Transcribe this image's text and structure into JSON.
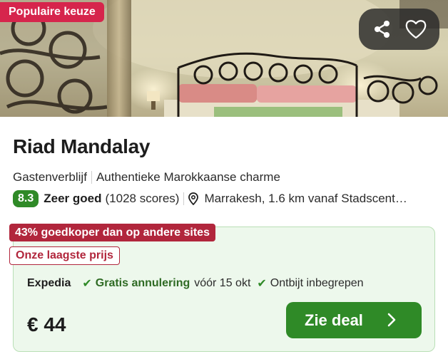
{
  "card": {
    "badge": "Populaire keuze",
    "title": "Riad Mandalay",
    "type": "Gastenverblijf",
    "tagline": "Authentieke Marokkaanse charme",
    "rating": {
      "score": "8.3",
      "label": "Zeer goed",
      "count": "(1028 scores)"
    },
    "location": "Marrakesh, 1.6 km vanaf Stadscentrum"
  },
  "icons": [
    "share-icon",
    "heart-icon",
    "checkmark-icon",
    "location-pin-icon",
    "chevron-right-icon"
  ],
  "deal": {
    "discount_tag": "43% goedkoper dan op andere sites",
    "lowest_tag": "Onze laagste prijs",
    "provider": "Expedia",
    "cancellation_label": "Gratis annulering",
    "cancellation_date": "vóór 15 okt",
    "breakfast": "Ontbijt inbegrepen",
    "price": "€ 44",
    "button_label": "Zie deal"
  },
  "colors": {
    "badge_red": "#d6254c",
    "tag_red": "#b1263c",
    "green": "#2f8a27",
    "deal_background": "#edf8ec"
  }
}
